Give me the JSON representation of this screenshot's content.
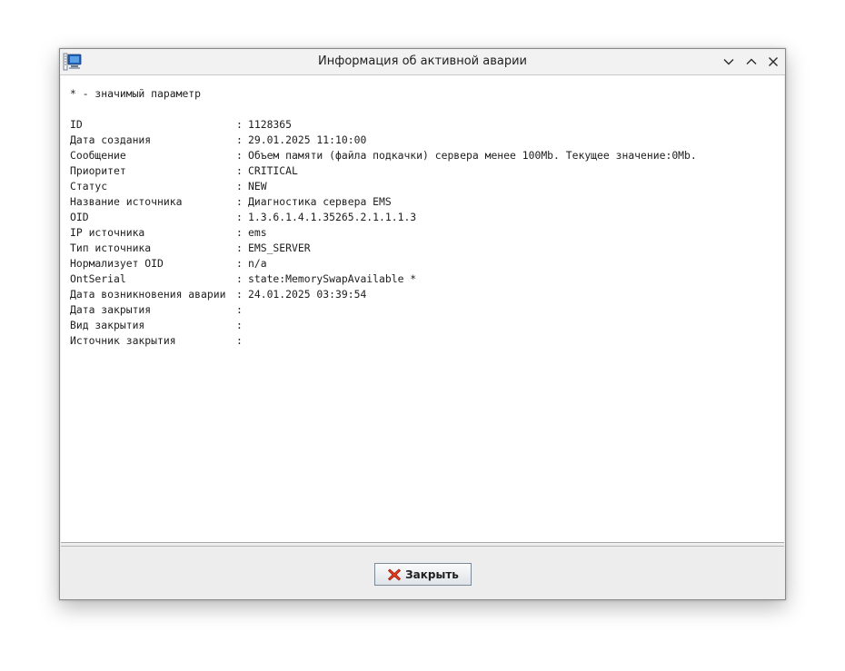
{
  "window": {
    "title": "Информация об активной аварии",
    "icon": "monitor-app-icon"
  },
  "content": {
    "note": "* - значимый параметр",
    "separator": ":",
    "fields": [
      {
        "label": "ID",
        "value": "1128365"
      },
      {
        "label": "Дата создания",
        "value": "29.01.2025 11:10:00"
      },
      {
        "label": "Сообщение",
        "value": "Объем памяти (файла подкачки) сервера менее 100Mb. Текущее значение:0Mb."
      },
      {
        "label": "Приоритет",
        "value": "CRITICAL"
      },
      {
        "label": "Статус",
        "value": "NEW"
      },
      {
        "label": "Название источника",
        "value": "Диагностика сервера EMS"
      },
      {
        "label": "OID",
        "value": "1.3.6.1.4.1.35265.2.1.1.1.3"
      },
      {
        "label": "IP источника",
        "value": "ems"
      },
      {
        "label": "Тип источника",
        "value": "EMS_SERVER"
      },
      {
        "label": "Нормализует OID",
        "value": "n/a"
      },
      {
        "label": "OntSerial",
        "value": "state:MemorySwapAvailable *"
      },
      {
        "label": "Дата возникновения аварии",
        "value": "24.01.2025 03:39:54"
      },
      {
        "label": "Дата закрытия",
        "value": ""
      },
      {
        "label": "Вид закрытия",
        "value": ""
      },
      {
        "label": "Источник закрытия",
        "value": ""
      }
    ]
  },
  "buttons": {
    "close_label": "Закрыть",
    "close_icon": "red-x-icon"
  },
  "colors": {
    "close_icon": "#e53b1f",
    "content_bg": "#ffffff",
    "dialog_bg": "#eeeeee"
  }
}
